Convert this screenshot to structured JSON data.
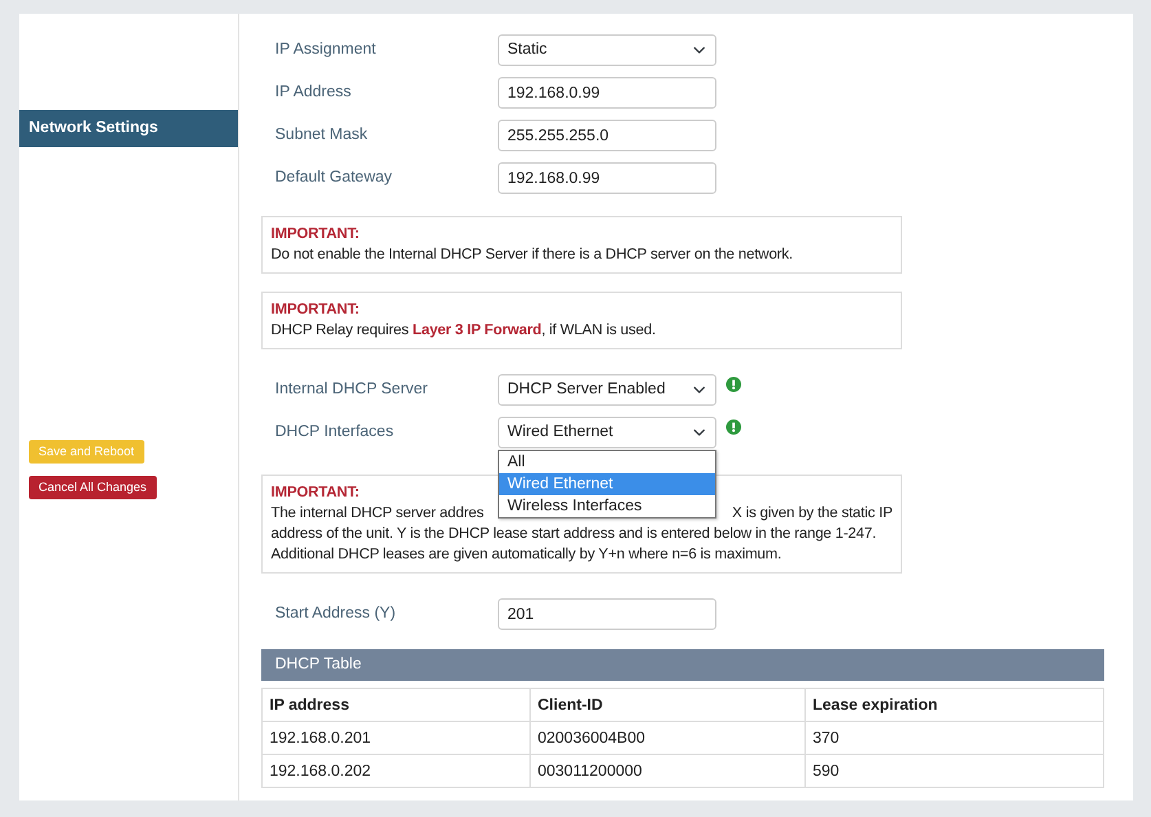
{
  "sidebar": {
    "items": [
      {
        "label": "Network Settings",
        "selected": true
      }
    ],
    "buttons": [
      {
        "label": "Save and Reboot",
        "kind": "warning"
      },
      {
        "label": "Cancel All Changes",
        "kind": "danger"
      }
    ]
  },
  "content": [
    {
      "kind": "select",
      "label": "IP Assignment",
      "value": "Static"
    },
    {
      "kind": "text",
      "label": "IP Address",
      "value": "192.168.0.99"
    },
    {
      "kind": "text",
      "label": "Subnet Mask",
      "value": "255.255.255.0"
    },
    {
      "kind": "text",
      "label": "Default Gateway",
      "value": "192.168.0.99"
    },
    {
      "kind": "note",
      "title": "IMPORTANT:",
      "text_parts": [
        "Do not enable the Internal DHCP Server if there is a DHCP server on the network."
      ]
    },
    {
      "kind": "note",
      "title": "IMPORTANT:",
      "text_parts": [
        "DHCP Relay requires **Layer 3 IP Forward**, if WLAN is used."
      ]
    },
    {
      "kind": "select",
      "label": "Internal DHCP Server",
      "value": "DHCP Server Enabled",
      "info": true
    },
    {
      "kind": "select",
      "label": "DHCP Interfaces",
      "value": "Wired Ethernet",
      "info": true,
      "expanded": true,
      "options": [
        {
          "label": "All",
          "selected": false
        },
        {
          "label": "Wired Ethernet",
          "selected": true
        },
        {
          "label": "Wireless Interfaces",
          "selected": false
        }
      ]
    },
    {
      "kind": "note",
      "title": "IMPORTANT:",
      "text_parts": [
        "The internal DHCP server addres",
        "X is given by the static IP",
        "address of the unit. Y is the DHCP lease start address and is entered below in the range 1-247. Additional DHCP leases are given automatically by Y+n where n=6 is maximum."
      ]
    },
    {
      "kind": "text",
      "label": "Start Address (Y)",
      "value": "201"
    },
    {
      "kind": "table",
      "title": "DHCP Table",
      "columns": [
        "IP address",
        "Client-ID",
        "Lease expiration"
      ],
      "rows": [
        [
          "192.168.0.201",
          "020036004B00",
          "370"
        ],
        [
          "192.168.0.202",
          "003011200000",
          "590"
        ]
      ]
    }
  ]
}
